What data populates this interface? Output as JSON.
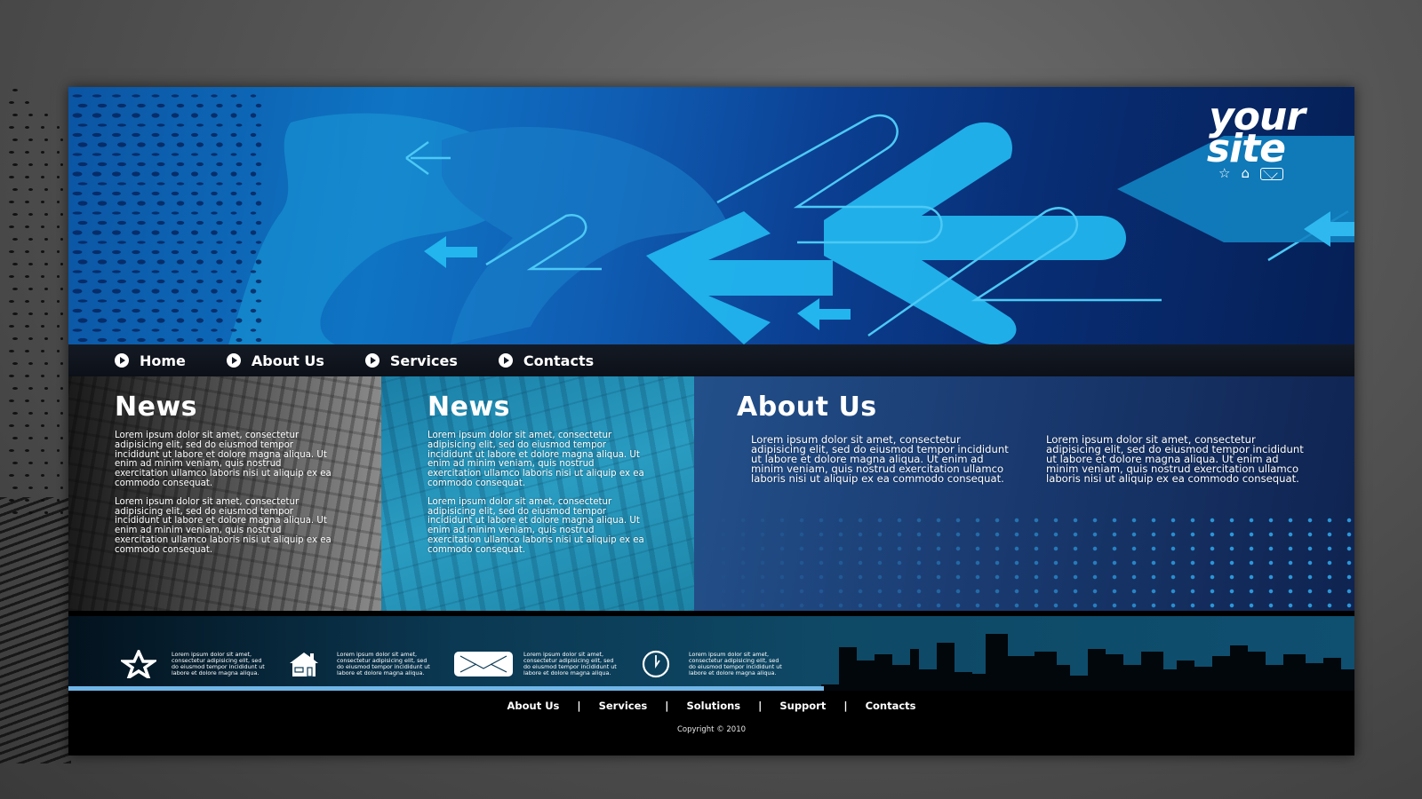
{
  "header": {
    "logo_line1": "your",
    "logo_line2": "site",
    "icons": [
      "star-icon",
      "home-icon",
      "mail-icon"
    ],
    "colors": {
      "accent": "#1fb0ee",
      "dark": "#061f55"
    }
  },
  "nav": {
    "items": [
      {
        "label": "Home"
      },
      {
        "label": "About Us"
      },
      {
        "label": "Services"
      },
      {
        "label": "Contacts"
      }
    ]
  },
  "content": {
    "news1": {
      "title": "News",
      "paragraphs": [
        "Lorem ipsum dolor sit amet, consectetur adipisicing elit, sed do eiusmod tempor incididunt ut labore et dolore magna aliqua. Ut enim ad minim veniam, quis nostrud exercitation ullamco laboris nisi ut aliquip ex ea commodo consequat.",
        "Lorem ipsum dolor sit amet, consectetur adipisicing elit, sed do eiusmod tempor incididunt ut labore et dolore magna aliqua. Ut enim ad minim veniam, quis nostrud exercitation ullamco laboris nisi ut aliquip ex ea commodo consequat."
      ]
    },
    "news2": {
      "title": "News",
      "paragraphs": [
        "Lorem ipsum dolor sit amet, consectetur adipisicing elit, sed do eiusmod tempor incididunt ut labore et dolore magna aliqua. Ut enim ad minim veniam, quis nostrud exercitation ullamco laboris nisi ut aliquip ex ea commodo consequat.",
        "Lorem ipsum dolor sit amet, consectetur adipisicing elit, sed do eiusmod tempor incididunt ut labore et dolore magna aliqua. Ut enim ad minim veniam, quis nostrud exercitation ullamco laboris nisi ut aliquip ex ea commodo consequat."
      ]
    },
    "about": {
      "title": "About Us",
      "paragraphs": [
        "Lorem ipsum dolor sit amet, consectetur adipisicing elit, sed do eiusmod tempor incididunt ut labore et dolore magna aliqua. Ut enim ad minim veniam, quis nostrud exercitation ullamco laboris nisi ut aliquip ex ea commodo consequat.",
        "Lorem ipsum dolor sit amet, consectetur adipisicing elit, sed do eiusmod tempor incididunt ut labore et dolore magna aliqua. Ut enim ad minim veniam, quis nostrud exercitation ullamco laboris nisi ut aliquip ex ea commodo consequat."
      ]
    }
  },
  "features": [
    {
      "icon": "star-icon",
      "text": "Lorem ipsum dolor sit amet, consectetur adipisicing elit, sed do eiusmod tempor incididunt ut labore et dolore magna aliqua."
    },
    {
      "icon": "home-icon",
      "text": "Lorem ipsum dolor sit amet, consectetur adipisicing elit, sed do eiusmod tempor incididunt ut labore et dolore magna aliqua."
    },
    {
      "icon": "mail-icon",
      "text": "Lorem ipsum dolor sit amet, consectetur adipisicing elit, sed do eiusmod tempor incididunt ut labore et dolore magna aliqua."
    },
    {
      "icon": "clock-icon",
      "text": "Lorem ipsum dolor sit amet, consectetur adipisicing elit, sed do eiusmod tempor incididunt ut labore et dolore magna aliqua."
    }
  ],
  "footer": {
    "links": [
      {
        "label": "About Us"
      },
      {
        "label": "Services"
      },
      {
        "label": "Solutions"
      },
      {
        "label": "Support"
      },
      {
        "label": "Contacts"
      }
    ],
    "separator": "|",
    "copyright": "Copyright © 2010"
  }
}
